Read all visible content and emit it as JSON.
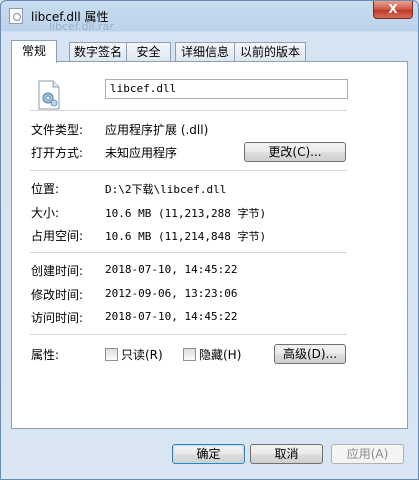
{
  "window": {
    "title": "libcef.dll 属性",
    "ghost_title": "libcef.dll.rar",
    "close_glyph": "X"
  },
  "tabs": [
    {
      "label": "常规",
      "active": true
    },
    {
      "label": "数字签名",
      "active": false
    },
    {
      "label": "安全",
      "active": false
    },
    {
      "label": "详细信息",
      "active": false
    },
    {
      "label": "以前的版本",
      "active": false
    }
  ],
  "general": {
    "filename": "libcef.dll",
    "file_type_label": "文件类型:",
    "file_type_value": "应用程序扩展 (.dll)",
    "opens_with_label": "打开方式:",
    "opens_with_value": "未知应用程序",
    "change_button": "更改(C)...",
    "location_label": "位置:",
    "location_value": "D:\\2下载\\libcef.dll",
    "size_label": "大小:",
    "size_value": "10.6 MB (11,213,288 字节)",
    "size_on_disk_label": "占用空间:",
    "size_on_disk_value": "10.6 MB (11,214,848 字节)",
    "created_label": "创建时间:",
    "created_value": "2018-07-10, 14:45:22",
    "modified_label": "修改时间:",
    "modified_value": "2012-09-06, 13:23:06",
    "accessed_label": "访问时间:",
    "accessed_value": "2018-07-10, 14:45:22",
    "attributes_label": "属性:",
    "readonly_label": "只读(R)",
    "readonly_checked": false,
    "hidden_label": "隐藏(H)",
    "hidden_checked": false,
    "advanced_button": "高级(D)..."
  },
  "footer": {
    "ok_button": "确定",
    "cancel_button": "取消",
    "apply_button": "应用(A)"
  },
  "colors": {
    "window_frame": "#c9dcef",
    "close_button": "#c0392b",
    "panel_border": "#8e9fb3"
  }
}
